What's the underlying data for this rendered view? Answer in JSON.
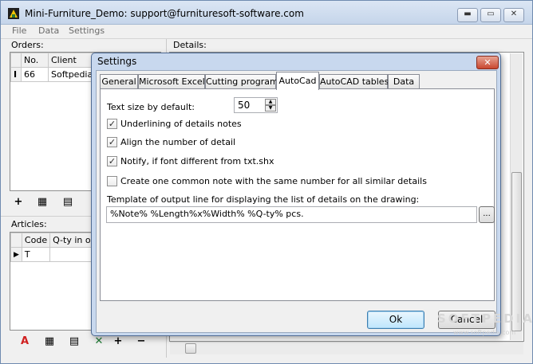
{
  "window": {
    "title": "Mini-Furniture_Demo: support@furnituresoft-software.com",
    "min_glyph": "▬",
    "max_glyph": "▭",
    "close_glyph": "✕"
  },
  "menu": [
    "File",
    "Data",
    "Settings"
  ],
  "orders": {
    "label": "Orders:",
    "columns": [
      "No.",
      "Client"
    ],
    "rows": [
      {
        "indicator": "I",
        "no": "66",
        "client": "Softpedia"
      }
    ]
  },
  "details": {
    "label": "Details:"
  },
  "articles": {
    "label": "Articles:",
    "columns": [
      "Code",
      "Q-ty in orde"
    ],
    "rows": [
      {
        "indicator": "▶",
        "code": "T",
        "qty": ""
      }
    ]
  },
  "toolbar_icons": {
    "add": "+",
    "calculator": "▦",
    "grid": "▤",
    "excel": "✕",
    "remove": "−",
    "text": "A"
  },
  "dialog": {
    "title": "Settings",
    "close_glyph": "✕",
    "tabs": [
      "General",
      "Microsoft Excel",
      "Cutting programs",
      "AutoCad",
      "AutoCAD tables",
      "Data"
    ],
    "active_tab": "AutoCad",
    "text_size_label": "Text size by default:",
    "text_size_value": "50",
    "checkboxes": [
      {
        "label": "Underlining of details notes",
        "checked": true,
        "mark": "✓"
      },
      {
        "label": "Align the number of detail",
        "checked": true,
        "mark": "✓"
      },
      {
        "label": "Notify, if font different from txt.shx",
        "checked": true,
        "mark": "✓"
      },
      {
        "label": "Create one common note with the same number for all similar details",
        "checked": false,
        "mark": ""
      }
    ],
    "template_label": "Template of output line for displaying the list of details on the drawing:",
    "template_value": "%Note% %Length%x%Width% %Q-ty% pcs.",
    "browse_label": "...",
    "ok_label": "Ok",
    "cancel_label": "Cancel"
  },
  "watermark": {
    "text": "SOFTPEDIA",
    "url": "www.softpedia.com"
  },
  "colors": {
    "title_bar": "#c5d5ea",
    "dialog_frame": "#c8d8ee",
    "close_red": "#c9472f"
  }
}
